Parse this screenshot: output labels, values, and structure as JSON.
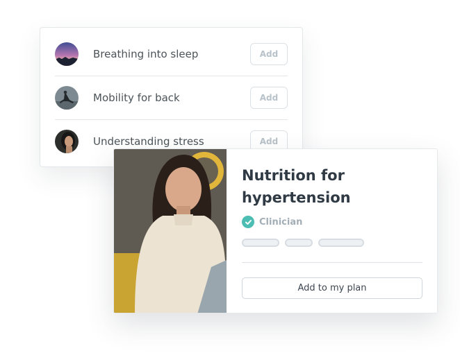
{
  "programs": [
    {
      "title": "Breathing into sleep",
      "add_label": "Add",
      "thumb": "night-sky-image"
    },
    {
      "title": "Mobility for back",
      "add_label": "Add",
      "thumb": "yoga-pose-image"
    },
    {
      "title": "Understanding stress",
      "add_label": "Add",
      "thumb": "woman-portrait-image"
    }
  ],
  "feature": {
    "title_line1": "Nutrition for",
    "title_line2": "hypertension",
    "author_label": "Clinician",
    "author_icon": "check-circle-icon",
    "cta_label": "Add to my plan",
    "photo": "woman-in-sweater-image"
  },
  "colors": {
    "accent_teal": "#4bbdb3",
    "text_dark": "#2f3a44",
    "muted": "#a3aeb6",
    "border": "#e4e7ea"
  }
}
